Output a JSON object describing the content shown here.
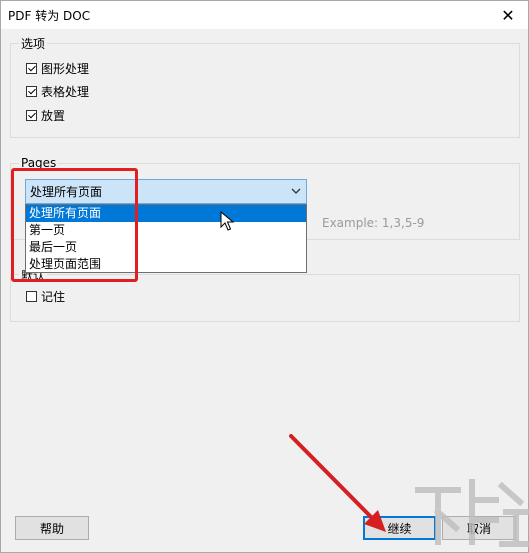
{
  "window": {
    "title": "PDF 转为 DOC",
    "close_glyph": "✕"
  },
  "options_group": {
    "legend": "选项",
    "items": [
      {
        "label": "图形处理",
        "checked": true
      },
      {
        "label": "表格处理",
        "checked": true
      },
      {
        "label": "放置",
        "checked": true
      }
    ]
  },
  "pages_group": {
    "legend": "Pages",
    "selected": "处理所有页面",
    "options": [
      "处理所有页面",
      "第一页",
      "最后一页",
      "处理页面范围"
    ],
    "highlighted_index": 0,
    "example": "Example: 1,3,5-9"
  },
  "default_group": {
    "legend": "默认",
    "remember_label": "记住",
    "remember_checked": false
  },
  "buttons": {
    "help": "帮助",
    "continue": "继续",
    "cancel": "取消"
  },
  "annotations": {
    "highlight_color": "#e02020",
    "arrow_color": "#d42020"
  },
  "icons": [
    "close-icon",
    "chevron-down-icon",
    "cursor-icon",
    "watermark-logo"
  ]
}
